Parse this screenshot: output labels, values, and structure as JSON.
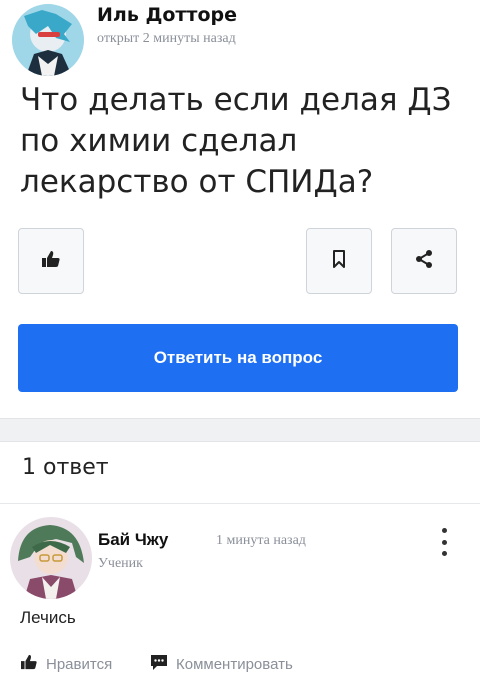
{
  "question": {
    "author": "Иль Дотторе",
    "time": "открыт 2 минуты назад",
    "text": "Что делать если делая ДЗ по химии сделал лекарство от СПИДа?",
    "answer_button_label": "Ответить на вопрос",
    "icons": {
      "like": "thumbs-up-icon",
      "bookmark": "bookmark-icon",
      "share": "share-icon"
    }
  },
  "answers_header": "1 ответ",
  "answer": {
    "author": "Бай Чжу",
    "time": "1 минута назад",
    "rank": "Ученик",
    "text": "Лечись",
    "like_label": "Нравится",
    "comment_label": "Комментировать"
  },
  "colors": {
    "accent": "#1f6ff2",
    "muted": "#8a8f99",
    "divider": "#f0f1f3"
  }
}
